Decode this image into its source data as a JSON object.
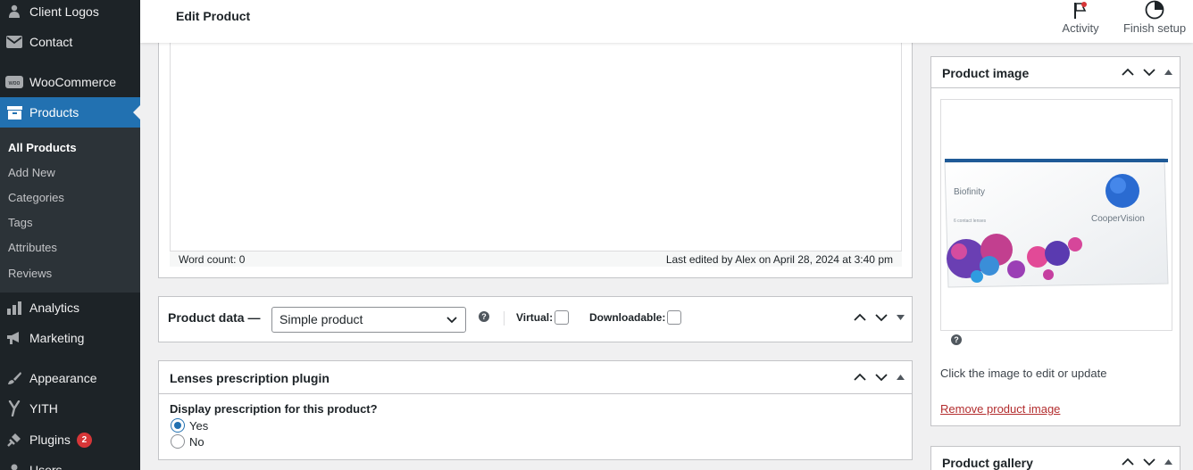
{
  "sidebar": {
    "items": [
      {
        "label": "Client Logos",
        "icon": "user-icon"
      },
      {
        "label": "Contact",
        "icon": "mail-icon"
      },
      {
        "label": "WooCommerce",
        "icon": "woo-icon"
      },
      {
        "label": "Products",
        "icon": "archive-icon"
      },
      {
        "label": "Analytics",
        "icon": "bar-chart-icon"
      },
      {
        "label": "Marketing",
        "icon": "megaphone-icon"
      },
      {
        "label": "Appearance",
        "icon": "paintbrush-icon"
      },
      {
        "label": "YITH",
        "icon": "yith-icon"
      },
      {
        "label": "Plugins",
        "icon": "plugin-icon",
        "badge": "2"
      },
      {
        "label": "Users",
        "icon": "users-icon"
      }
    ],
    "submenu": [
      "All Products",
      "Add New",
      "Categories",
      "Tags",
      "Attributes",
      "Reviews"
    ],
    "active_color": "#2271b1"
  },
  "header": {
    "title": "Edit Product",
    "activity_label": "Activity",
    "finish_setup_label": "Finish setup"
  },
  "editor": {
    "word_count": "Word count: 0",
    "last_edited": "Last edited by Alex on April 28, 2024 at 3:40 pm"
  },
  "product_data": {
    "title": "Product data —",
    "type_selected": "Simple product",
    "virtual_label": "Virtual:",
    "downloadable_label": "Downloadable:"
  },
  "lenses": {
    "title": "Lenses prescription plugin",
    "question": "Display prescription for this product?",
    "options": [
      "Yes",
      "No"
    ],
    "selected": "Yes"
  },
  "product_image": {
    "title": "Product image",
    "brand": "Biofinity",
    "maker": "CooperVision",
    "pack": "6 contact lenses",
    "caption": "Click the image to edit or update",
    "remove_label": "Remove product image"
  },
  "product_gallery": {
    "title": "Product gallery"
  }
}
